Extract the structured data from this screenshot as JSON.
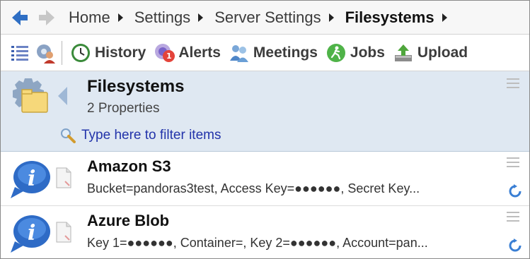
{
  "breadcrumb": {
    "items": [
      "Home",
      "Settings",
      "Server Settings",
      "Filesystems"
    ]
  },
  "toolbar": {
    "buttons": [
      {
        "label": "History",
        "icon": "history-clock-icon"
      },
      {
        "label": "Alerts",
        "icon": "alerts-icon",
        "badge": "1"
      },
      {
        "label": "Meetings",
        "icon": "meetings-people-icon"
      },
      {
        "label": "Jobs",
        "icon": "jobs-runner-icon"
      },
      {
        "label": "Upload",
        "icon": "upload-icon"
      }
    ]
  },
  "panel": {
    "title": "Filesystems",
    "subtitle": "2 Properties",
    "filter_placeholder": "Type here to filter items"
  },
  "items": [
    {
      "title": "Amazon S3",
      "description": "Bucket=pandoras3test, Access Key=●●●●●●, Secret Key..."
    },
    {
      "title": "Azure Blob",
      "description": "Key 1=●●●●●●, Container=, Key 2=●●●●●●, Account=pan..."
    }
  ],
  "colors": {
    "nav_arrow": "#2f6fc4",
    "header_bg": "#dfe8f2",
    "filter_link": "#2233aa",
    "badge": "#e4433a"
  }
}
